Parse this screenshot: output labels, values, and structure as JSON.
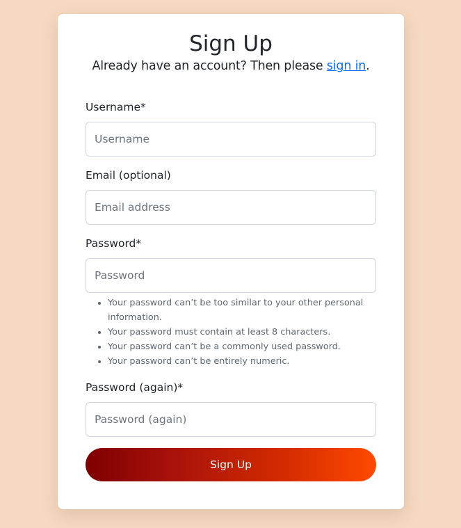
{
  "page": {
    "title": "Sign Up",
    "subtitle_prefix": "Already have an account? Then please ",
    "signin_link": "sign in",
    "subtitle_suffix": "."
  },
  "form": {
    "username": {
      "label": "Username*",
      "placeholder": "Username",
      "value": ""
    },
    "email": {
      "label": "Email (optional)",
      "placeholder": "Email address",
      "value": ""
    },
    "password": {
      "label": "Password*",
      "placeholder": "Password",
      "value": ""
    },
    "password_help": [
      "Your password can’t be too similar to your other personal information.",
      "Your password must contain at least 8 characters.",
      "Your password can’t be a commonly used password.",
      "Your password can’t be entirely numeric."
    ],
    "password_again": {
      "label": "Password (again)*",
      "placeholder": "Password (again)",
      "value": ""
    },
    "submit_label": "Sign Up"
  },
  "colors": {
    "background": "#f6d9c1",
    "link": "#0d6efd",
    "button_gradient_start": "#7e0000",
    "button_gradient_end": "#ff4a00"
  }
}
